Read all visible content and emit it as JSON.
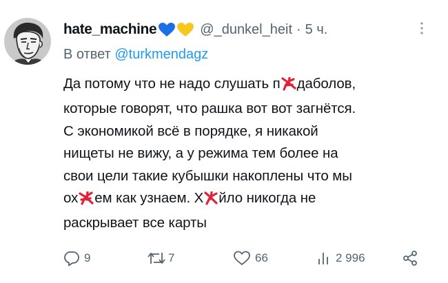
{
  "tweet": {
    "display_name": "hate_machine",
    "handle": "@_dunkel_heit",
    "separator": "·",
    "time": "5 ч.",
    "reply_prefix": "В ответ",
    "reply_to": "@turkmendagz",
    "lines": {
      "l1a": "Да потому что не надо слушать п",
      "l1b": "даболов,",
      "l2": "которые говорят, что рашка вот вот загнётся.",
      "l3": "С экономикой всё в порядке, я никакой",
      "l4": "нищеты не вижу, а у режима тем более на",
      "l5": "свои цели такие кубышки накоплены что мы",
      "l6a": "ох",
      "l6b": "ем как узнаем. Х",
      "l6c": "йло никогда не",
      "l7": "раскрывает все карты"
    },
    "stats": {
      "replies": "9",
      "reposts": "7",
      "likes": "66",
      "views": "2 996"
    },
    "colors": {
      "text": "#0f1419",
      "secondary": "#536471",
      "link": "#1d9bf0",
      "heart_blue": "#1d6fe8",
      "heart_yellow": "#f7c71e",
      "censor_red": "#e0223a"
    }
  }
}
